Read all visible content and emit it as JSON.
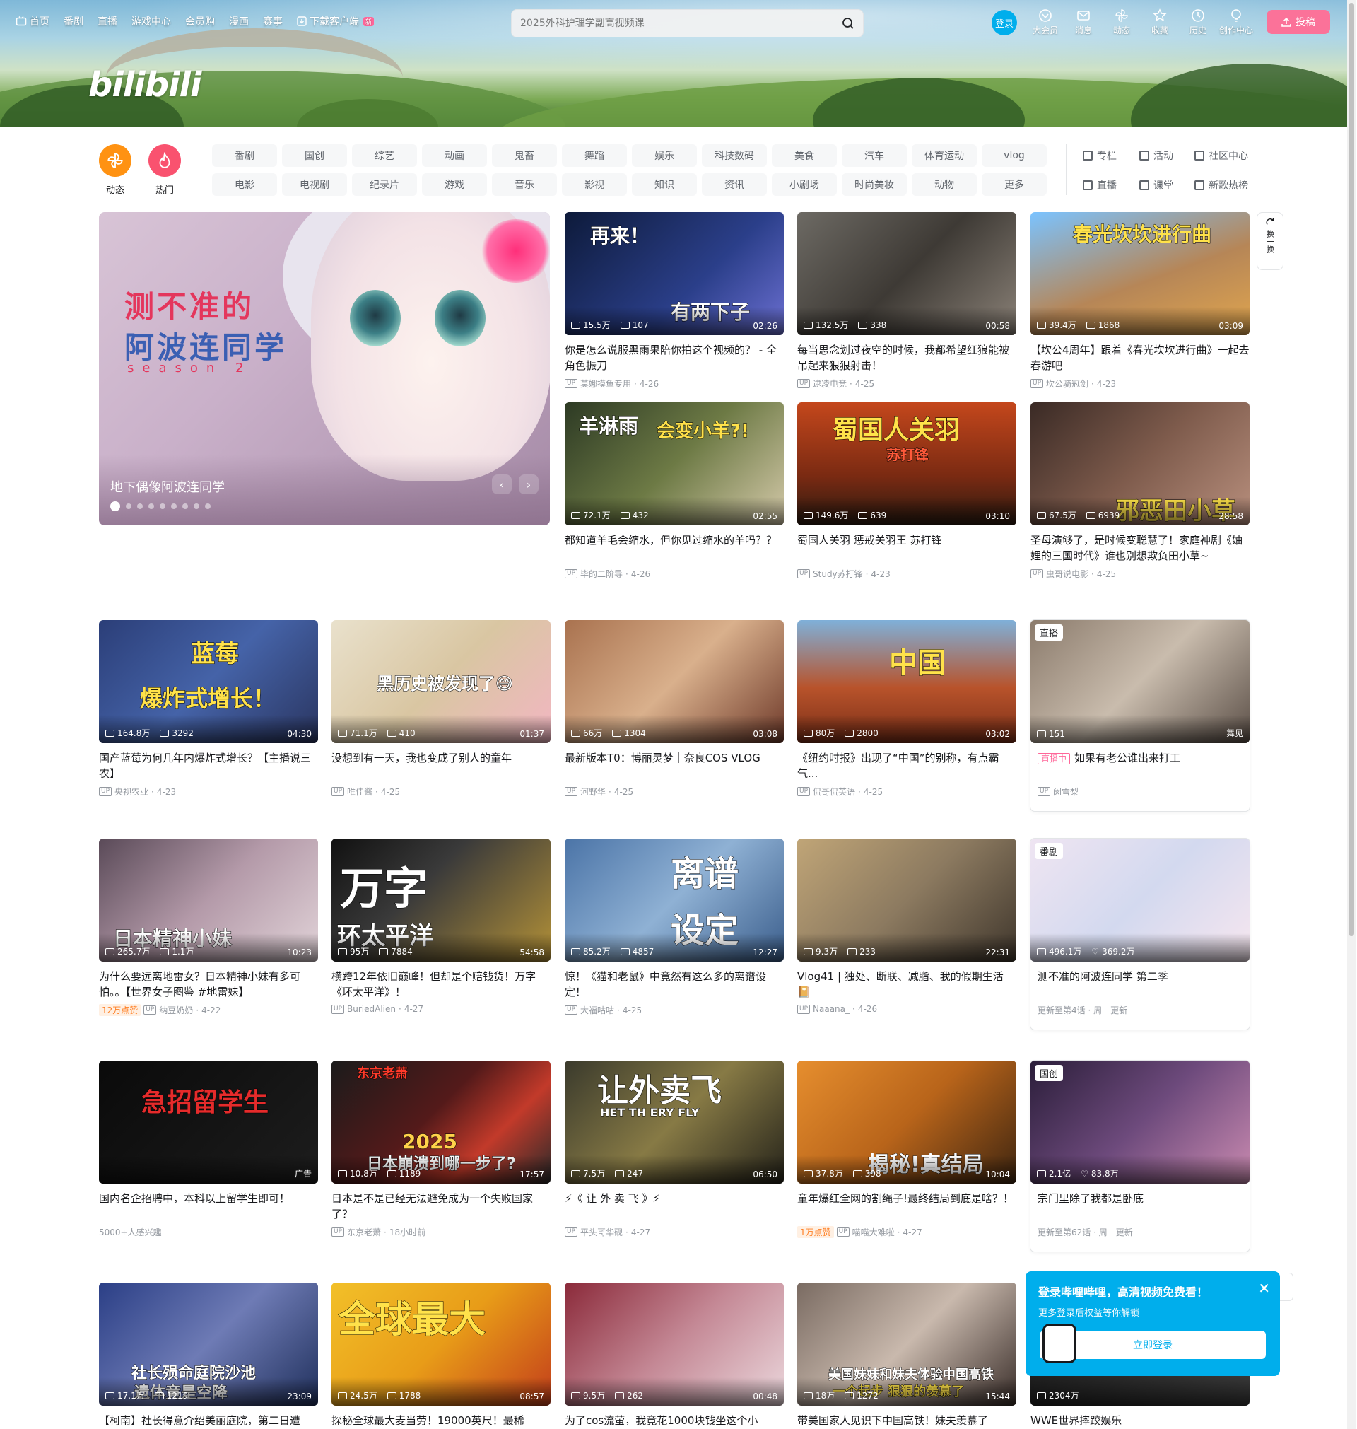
{
  "topnav": {
    "home": "首页",
    "bangumi": "番剧",
    "live": "直播",
    "game": "游戏中心",
    "vip": "会员购",
    "manga": "漫画",
    "match": "赛事",
    "download": "下载客户端",
    "new_badge": "新"
  },
  "search": {
    "placeholder": "2025外科护理学副高视频课"
  },
  "header_right": {
    "login": "登录",
    "items": [
      "大会员",
      "消息",
      "动态",
      "收藏",
      "历史",
      "创作中心"
    ],
    "upload": "投稿"
  },
  "channels": {
    "dynamic": "动态",
    "hot": "热门",
    "row1": [
      "番剧",
      "国创",
      "综艺",
      "动画",
      "鬼畜",
      "舞蹈",
      "娱乐",
      "科技数码",
      "美食",
      "汽车",
      "体育运动",
      "vlog"
    ],
    "row2": [
      "电影",
      "电视剧",
      "纪录片",
      "游戏",
      "音乐",
      "影视",
      "知识",
      "资讯",
      "小剧场",
      "时尚美妆",
      "动物",
      "更多"
    ],
    "side": [
      "专栏",
      "活动",
      "社区中心",
      "直播",
      "课堂",
      "新歌热榜"
    ]
  },
  "carousel": {
    "title_line1": "测不准的",
    "title_line2": "阿波连同学",
    "season": "season 2",
    "caption": "地下偶像阿波连同学",
    "prev": "‹",
    "next": "›"
  },
  "refresh": {
    "label": "换一换"
  },
  "cards": [
    {
      "views": "15.5万",
      "danmaku": "107",
      "duration": "02:26",
      "title": "你是怎么说服黑雨果陪你拍这个视频的？ - 全角色振刀",
      "author": "莫娜摸鱼专用",
      "date": "4-26",
      "thumb_text": "再来！",
      "thumb_text2": "有两下子"
    },
    {
      "views": "132.5万",
      "danmaku": "338",
      "duration": "00:58",
      "title": "每当思念划过夜空的时候，我都希望红狼能被吊起来狠狠射击！",
      "author": "逮凌电竞",
      "date": "4-25"
    },
    {
      "views": "39.4万",
      "danmaku": "1868",
      "duration": "03:09",
      "title": "【坎公4周年】跟着《春光坎坎进行曲》一起去春游吧",
      "author": "坎公骑冠剑",
      "date": "4-23",
      "thumb_text": "春光坎坎进行曲"
    },
    {
      "views": "72.1万",
      "danmaku": "432",
      "duration": "02:55",
      "title": "都知道羊毛会缩水，但你见过缩水的羊吗？？",
      "author": "毕的二阶导",
      "date": "4-26",
      "thumb_text": "羊淋雨",
      "thumb_text2": "会变小羊?!"
    },
    {
      "views": "149.6万",
      "danmaku": "639",
      "duration": "03:10",
      "title": "蜀国人关羽 惩戒关羽王 苏打锋",
      "author": "Study苏打锋",
      "date": "4-23",
      "thumb_text": "蜀国人关羽",
      "thumb_text2": "苏打锋"
    },
    {
      "views": "67.5万",
      "danmaku": "6939",
      "duration": "28:58",
      "title": "圣母演够了，是时候变聪慧了！家庭神剧《妯娌的三国时代》谁也别想欺负田小草~",
      "author": "虫哥说电影",
      "date": "4-25",
      "thumb_text": "邪恶田小草"
    },
    {
      "views": "164.8万",
      "danmaku": "3292",
      "duration": "04:30",
      "title": "国产蓝莓为何几年内爆炸式增长？【主播说三农】",
      "author": "央视农业",
      "date": "4-23",
      "thumb_text": "蓝莓",
      "thumb_text2": "爆炸式增长！"
    },
    {
      "views": "71.1万",
      "danmaku": "410",
      "duration": "01:37",
      "title": "没想到有一天，我也变成了别人的童年",
      "author": "唯佳酱",
      "date": "4-25",
      "thumb_text": "黑历史被发现了😅"
    },
    {
      "views": "66万",
      "danmaku": "1304",
      "duration": "03:08",
      "title": "最新版本T0：博丽灵梦｜奈良COS VLOG",
      "author": "河野华",
      "date": "4-25"
    },
    {
      "views": "80万",
      "danmaku": "2800",
      "duration": "03:02",
      "title": "《纽约时报》出现了“中国”的别称，有点霸气...",
      "author": "侃哥侃英语",
      "date": "4-25",
      "thumb_text": "中国"
    },
    {
      "live_tag": "直播",
      "views": "151",
      "category": "舞见",
      "live_badge": "直播中",
      "title": "如果有老公谁出来打工",
      "author": "闵雪梨"
    },
    {
      "views": "265.7万",
      "danmaku": "1.1万",
      "duration": "10:23",
      "title": "为什么要远离地雷女？日本精神小妹有多可怕。。【世界女子图鉴 #地雷妹】",
      "badge": "12万点赞",
      "author": "纳豆奶奶",
      "date": "4-22",
      "thumb_text": "日本精神小妹"
    },
    {
      "views": "95万",
      "danmaku": "7884",
      "duration": "54:58",
      "title": "横跨12年依旧巅峰！但却是个赔钱货！万字《环太平洋》！",
      "author": "BuriedAlien",
      "date": "4-27",
      "thumb_text": "万字",
      "thumb_text2": "环太平洋"
    },
    {
      "views": "85.2万",
      "danmaku": "4857",
      "duration": "12:27",
      "title": "惊！《猫和老鼠》中竟然有这么多的离谱设定！",
      "author": "大福咕咕",
      "date": "4-25",
      "thumb_text": "离谱",
      "thumb_text2": "设定"
    },
    {
      "views": "9.3万",
      "danmaku": "233",
      "duration": "22:31",
      "title": "Vlog41 | 独处、断联、减脂、我的假期生活📔",
      "author": "Naaana_",
      "date": "4-26"
    },
    {
      "type_tag": "番剧",
      "views": "496.1万",
      "likes": "369.2万",
      "title": "测不准的阿波连同学 第二季",
      "update": "更新至第4话 · 周一更新"
    },
    {
      "ad_label": "广告",
      "title": "国内名企招聘中，本科以上留学生即可！",
      "interest": "5000+人感兴趣",
      "thumb_text": "急招留学生"
    },
    {
      "views": "10.8万",
      "danmaku": "1189",
      "duration": "17:57",
      "title": "日本是不是已经无法避免成为一个失败国家了？",
      "author": "东京老萧",
      "date": "18小时前",
      "thumb_text": "2025",
      "thumb_text2": "日本崩溃到哪一步了?",
      "thumb_text3": "东京老萧"
    },
    {
      "views": "7.5万",
      "danmaku": "247",
      "duration": "06:50",
      "title": "⚡《 让 外 卖 飞 》⚡",
      "author": "平头哥华砚",
      "date": "4-27",
      "thumb_text": "让外卖飞",
      "thumb_text2": "HET TH ERY FLY"
    },
    {
      "views": "37.8万",
      "danmaku": "398",
      "duration": "10:04",
      "title": "童年爆红全网的割绳子!最终结局到底是啥？！",
      "badge": "1万点赞",
      "author": "喵喵大难啦",
      "date": "4-27",
      "thumb_text": "揭秘!真结局"
    },
    {
      "type_tag": "国创",
      "views": "2.1亿",
      "likes": "83.8万",
      "title": "宗门里除了我都是卧底",
      "update": "更新至第62话 · 周一更新"
    },
    {
      "views": "17.1万",
      "danmaku": "1219",
      "duration": "23:09",
      "title": "【柯南】社长得意介绍美丽庭院，第二日遭",
      "thumb_text": "社长殒命庭院沙池",
      "thumb_text2": "遗体竟是空降"
    },
    {
      "views": "24.5万",
      "danmaku": "1788",
      "duration": "08:57",
      "title": "探秘全球最大麦当劳！19000英尺！最稀",
      "thumb_text": "全球最大"
    },
    {
      "views": "9.5万",
      "danmaku": "262",
      "duration": "00:48",
      "title": "为了cos流萤，我竟花1000块钱坐这个小"
    },
    {
      "views": "18万",
      "danmaku": "1272",
      "duration": "15:44",
      "title": "带美国家人见识下中国高铁！妹夫羡慕了",
      "thumb_text": "美国妹妹和妹夫体验中国高铁",
      "thumb_text2": "一个起步 狠狠的羡慕了"
    },
    {
      "views": "2304万",
      "title": "WWE世界摔跤娱乐"
    }
  ],
  "popup": {
    "title": "登录哔哩哔哩，高清视频免费看！",
    "subtitle": "更多登录后权益等你解锁",
    "button": "立即登录",
    "close": "✕"
  },
  "logo": "bilibili"
}
